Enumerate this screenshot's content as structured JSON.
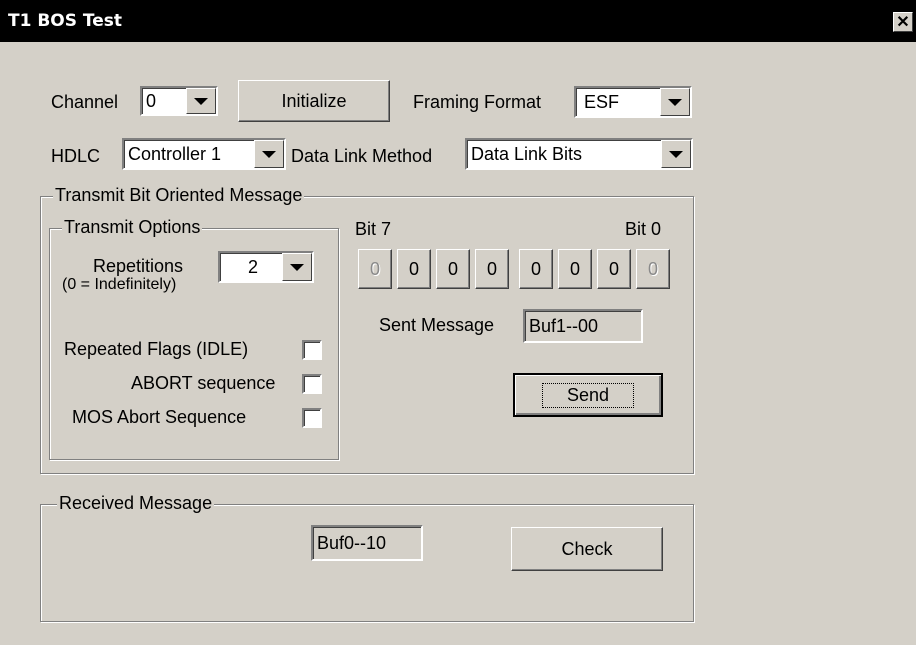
{
  "window": {
    "title": "T1 BOS Test",
    "close_glyph": "✕"
  },
  "channel": {
    "label": "Channel",
    "value": "0"
  },
  "initialize_label": "Initialize",
  "framing": {
    "label": "Framing Format",
    "value": "ESF"
  },
  "hdlc": {
    "label": "HDLC",
    "value": "Controller 1"
  },
  "data_link": {
    "label": "Data Link Method",
    "value": "Data Link Bits"
  },
  "transmit": {
    "group_title": "Transmit Bit Oriented Message",
    "options_title": "Transmit Options",
    "repetitions_label": "Repetitions",
    "repetitions_note": "(0 = Indefinitely)",
    "repetitions_value": "2",
    "repeated_flags_label": "Repeated Flags (IDLE)",
    "abort_label": "ABORT sequence",
    "mos_abort_label": "MOS Abort Sequence",
    "bit7_label": "Bit 7",
    "bit0_label": "Bit 0",
    "bits": [
      "0",
      "0",
      "0",
      "0",
      "0",
      "0",
      "0",
      "0"
    ],
    "sent_label": "Sent Message",
    "sent_value": "Buf1--00",
    "send_label": "Send"
  },
  "received": {
    "group_title": "Received Message",
    "value": "Buf0--10",
    "check_label": "Check"
  }
}
